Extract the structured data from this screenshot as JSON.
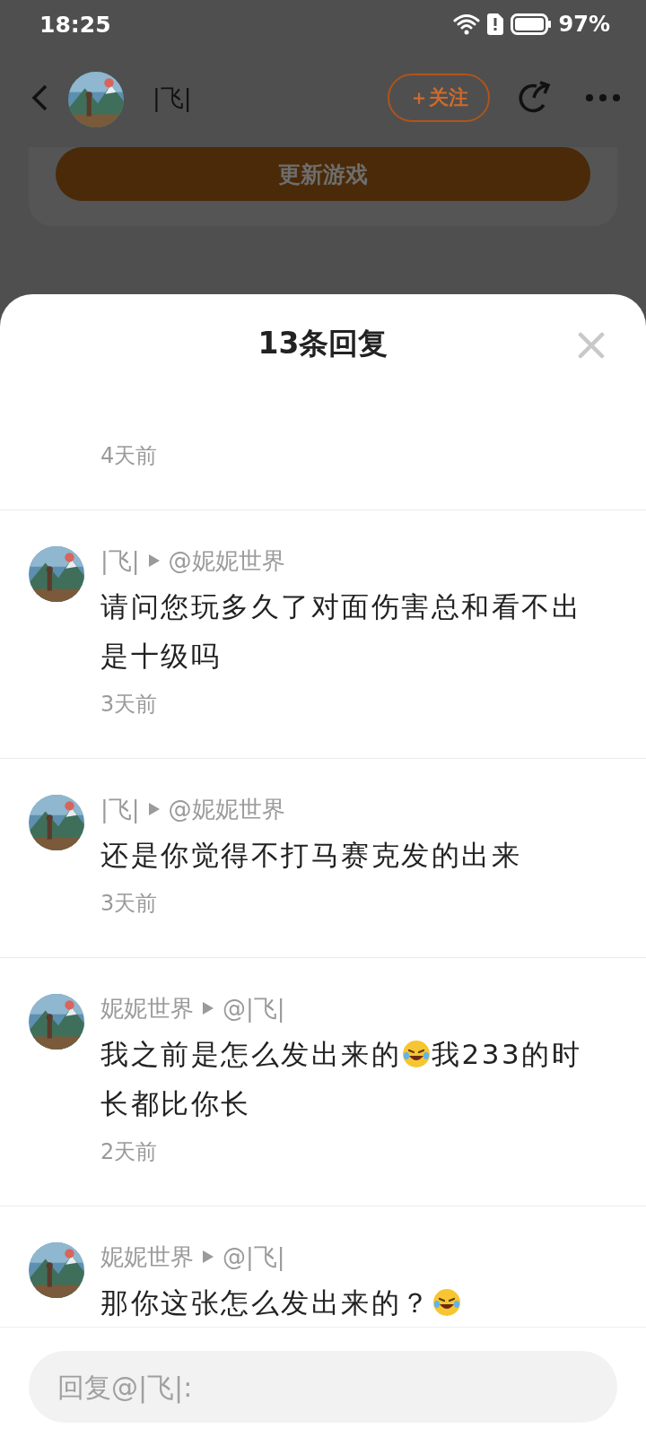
{
  "status_bar": {
    "time": "18:25",
    "battery": "97%"
  },
  "header": {
    "username": "|飞|",
    "follow_button": "＋关注"
  },
  "background_button": "更新游戏",
  "sheet": {
    "title": "13条回复"
  },
  "replies": [
    {
      "time": "4天前"
    },
    {
      "author": "|飞|",
      "target": "@妮妮世界",
      "body": [
        {
          "kind": "text",
          "text": "请问您玩多久了对面伤害总和看不出是十级吗"
        }
      ],
      "time": "3天前"
    },
    {
      "author": "|飞|",
      "target": "@妮妮世界",
      "body": [
        {
          "kind": "text",
          "text": "还是你觉得不打马赛克发的出来"
        }
      ],
      "time": "3天前"
    },
    {
      "author": "妮妮世界",
      "target": "@|飞|",
      "body": [
        {
          "kind": "text",
          "text": "我之前是怎么发出来的"
        },
        {
          "kind": "emoji"
        },
        {
          "kind": "text",
          "text": "我233的时"
        },
        {
          "kind": "text",
          "text": "长都比你长"
        }
      ],
      "time": "2天前"
    },
    {
      "author": "妮妮世界",
      "target": "@|飞|",
      "body": [
        {
          "kind": "text",
          "text": "那你这张怎么发出来的？"
        },
        {
          "kind": "emoji"
        }
      ]
    }
  ],
  "reply_input": {
    "placeholder": "回复@|飞|:"
  }
}
